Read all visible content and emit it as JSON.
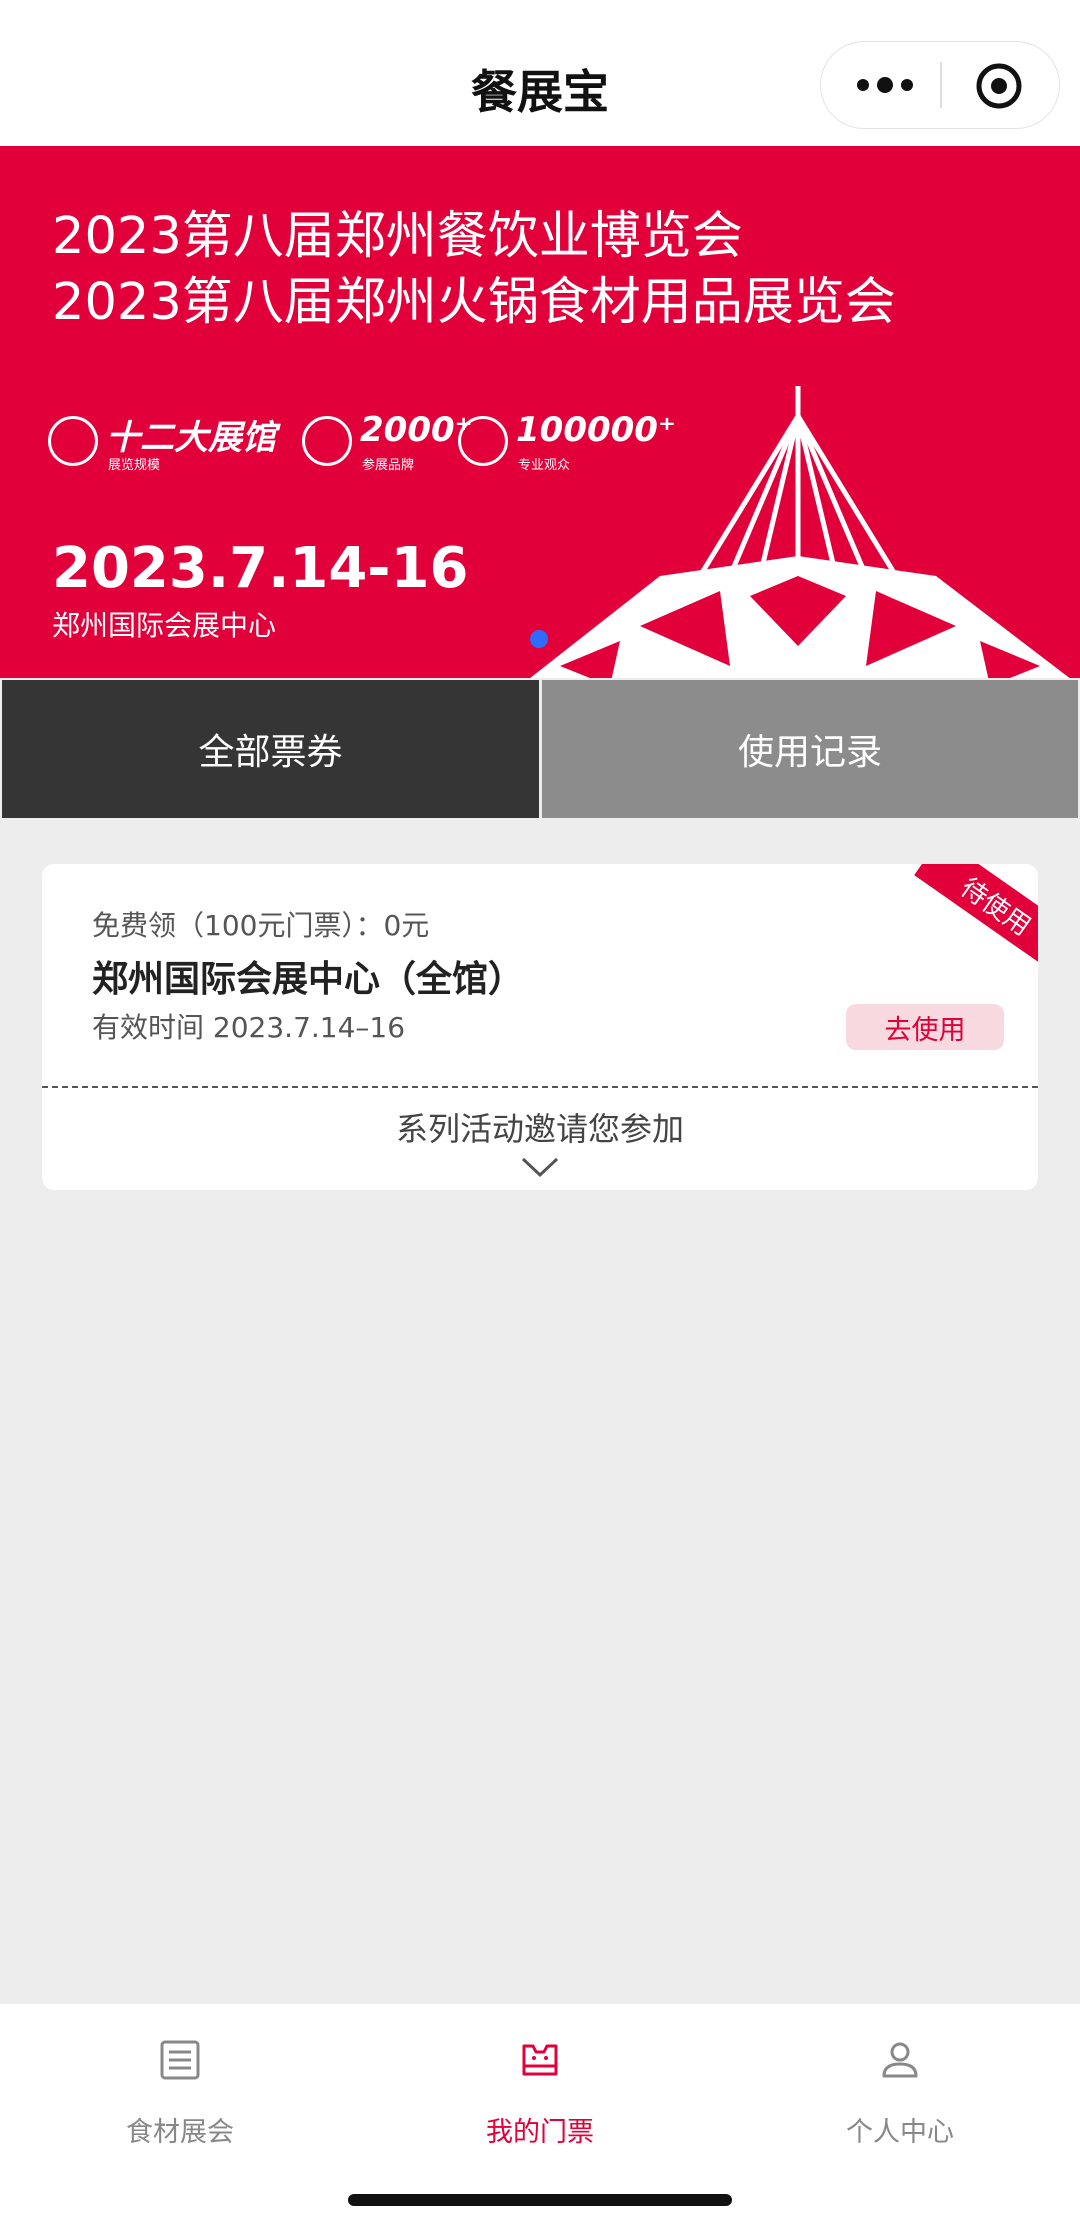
{
  "nav": {
    "title": "餐展宝"
  },
  "banner": {
    "title_line1": "2023第八届郑州餐饮业博览会",
    "title_line2": "2023第八届郑州火锅食材用品展览会",
    "stats": [
      {
        "big": "十二大展馆",
        "small": "展览规模"
      },
      {
        "big": "2000⁺",
        "small": "参展品牌"
      },
      {
        "big": "100000⁺",
        "small": "专业观众"
      }
    ],
    "date": "2023.7.14-16",
    "venue": "郑州国际会展中心"
  },
  "tabs": {
    "all": "全部票券",
    "records": "使用记录"
  },
  "ticket": {
    "price_line": "免费领（100元门票）：0元",
    "name": "郑州国际会展中心（全馆）",
    "valid_label": "有效时间",
    "valid_date": "2023.7.14–16",
    "status": "待使用",
    "use_button": "去使用",
    "invite": "系列活动邀请您参加"
  },
  "tabbar": {
    "items": [
      {
        "label": "食材展会",
        "icon": "list-doc-icon"
      },
      {
        "label": "我的门票",
        "icon": "ticket-icon",
        "active": true
      },
      {
        "label": "个人中心",
        "icon": "person-icon"
      }
    ]
  },
  "colors": {
    "brand_red": "#e1003a",
    "tab_dark": "#353535",
    "tab_grey": "#8c8c8c"
  }
}
